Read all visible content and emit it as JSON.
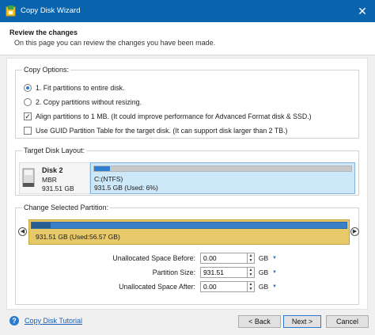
{
  "window": {
    "title": "Copy Disk Wizard",
    "close_glyph": "✕",
    "app_icon": "wizard-icon"
  },
  "header": {
    "title": "Review the changes",
    "subtitle": "On this page you can review the changes you have been made."
  },
  "copy_options": {
    "legend": "Copy Options:",
    "opt1": {
      "label": "1. Fit partitions to entire disk.",
      "selected": true
    },
    "opt2": {
      "label": "2. Copy partitions without resizing.",
      "selected": false
    },
    "align": {
      "label": "Align partitions to 1 MB.  (It could improve performance for Advanced Format disk & SSD.)",
      "checked": true
    },
    "gpt": {
      "label": "Use GUID Partition Table for the target disk. (It can support disk larger than 2 TB.)",
      "checked": false
    }
  },
  "target_layout": {
    "legend": "Target Disk Layout:",
    "disk": {
      "name": "Disk 2",
      "type": "MBR",
      "size": "931.51 GB"
    },
    "partition": {
      "label": "C:(NTFS)",
      "used_text": "931.5 GB (Used: 6%)",
      "used_fraction": 0.06
    }
  },
  "change_partition": {
    "legend": "Change Selected Partition:",
    "left_arrow": "◀",
    "right_arrow": "▶",
    "partition_label": "931.51 GB (Used:56.57 GB)",
    "used_fraction": 0.06,
    "fields": {
      "before": {
        "label": "Unallocated Space Before:",
        "value": "0.00",
        "unit": "GB"
      },
      "size": {
        "label": "Partition Size:",
        "value": "931.51",
        "unit": "GB"
      },
      "after": {
        "label": "Unallocated Space After:",
        "value": "0.00",
        "unit": "GB"
      }
    },
    "spin_up": "▲",
    "spin_down": "▼",
    "dropdown": "▼"
  },
  "footer": {
    "help_glyph": "?",
    "tutorial_link": "Copy Disk Tutorial",
    "back_label": "< Back",
    "next_label": "Next >",
    "cancel_label": "Cancel"
  },
  "colors": {
    "titlebar": "#0a64ad",
    "partition_selected": "#cde8f8",
    "used_fill": "#2f7fd0",
    "change_partition_bg": "#e8c96a"
  }
}
